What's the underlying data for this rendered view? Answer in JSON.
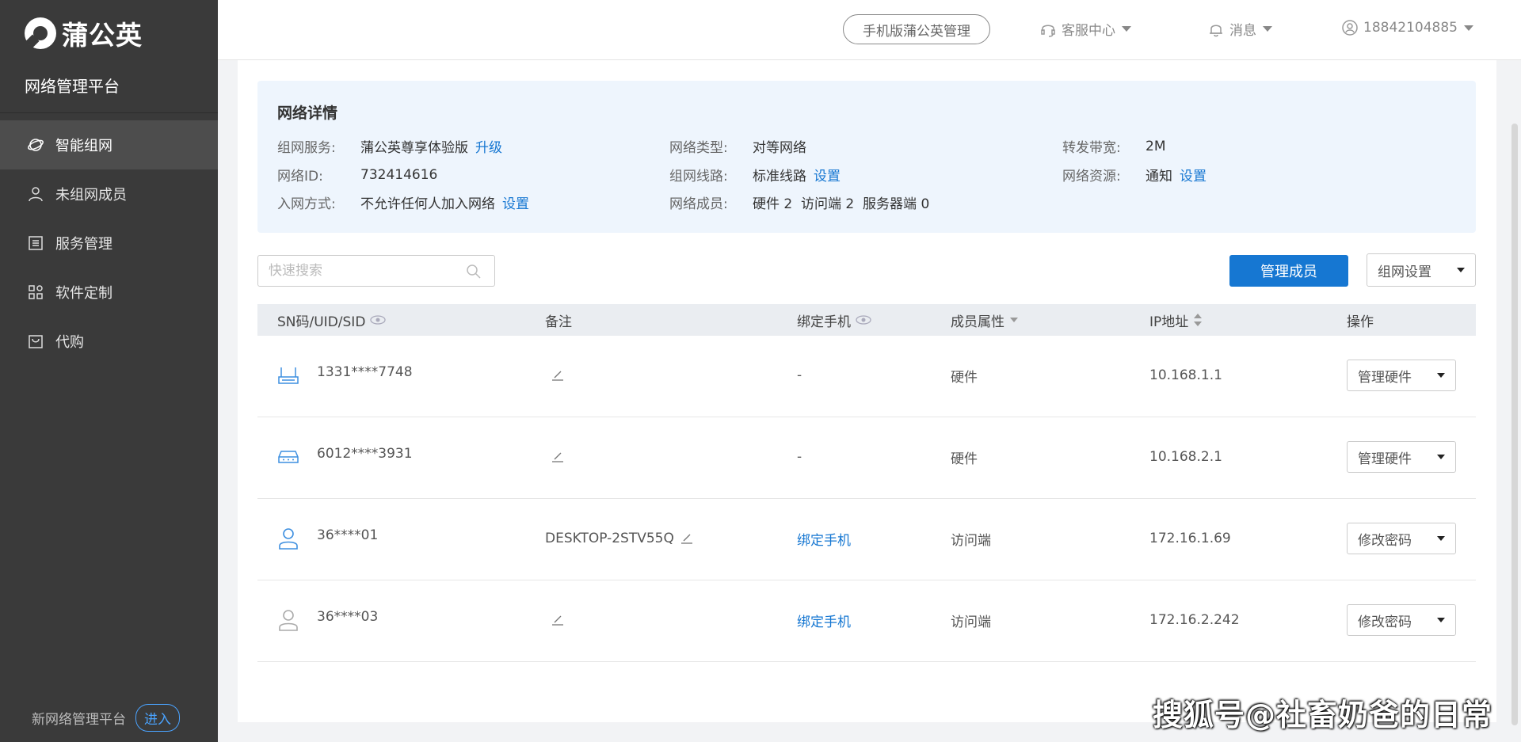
{
  "brand": {
    "name": "蒲公英",
    "platform_title": "网络管理平台"
  },
  "sidebar": {
    "items": [
      {
        "label": "智能组网",
        "icon": "network-icon",
        "active": true
      },
      {
        "label": "未组网成员",
        "icon": "user-icon"
      },
      {
        "label": "服务管理",
        "icon": "list-icon"
      },
      {
        "label": "软件定制",
        "icon": "grid-icon"
      },
      {
        "label": "代购",
        "icon": "bag-icon"
      }
    ],
    "footer_text": "新网络管理平台",
    "footer_button": "进入"
  },
  "topbar": {
    "mobile_button": "手机版蒲公英管理",
    "support": "客服中心",
    "messages": "消息",
    "account": "18842104885"
  },
  "detail": {
    "title": "网络详情",
    "service_label": "组网服务:",
    "service_value": "蒲公英尊享体验版",
    "service_link": "升级",
    "type_label": "网络类型:",
    "type_value": "对等网络",
    "bandwidth_label": "转发带宽:",
    "bandwidth_value": "2M",
    "id_label": "网络ID:",
    "id_value": "732414616",
    "route_label": "组网线路:",
    "route_value": "标准线路",
    "route_link": "设置",
    "resource_label": "网络资源:",
    "resource_value": "通知",
    "resource_link": "设置",
    "join_label": "入网方式:",
    "join_value": "不允许任何人加入网络",
    "join_link": "设置",
    "members_label": "网络成员:",
    "members_value": "硬件 2  访问端 2  服务器端 0"
  },
  "toolbar": {
    "search_placeholder": "快速搜索",
    "manage_members": "管理成员",
    "network_settings": "组网设置"
  },
  "table": {
    "columns": {
      "sn": "SN码/UID/SID",
      "note": "备注",
      "phone": "绑定手机",
      "attr": "成员属性",
      "ip": "IP地址",
      "action": "操作"
    },
    "rows": [
      {
        "icon": "router-icon",
        "sn": "1331****7748",
        "note": "",
        "phone": "-",
        "phone_link": false,
        "attr": "硬件",
        "ip": "10.168.1.1",
        "action": "管理硬件"
      },
      {
        "icon": "box-router-icon",
        "sn": "6012****3931",
        "note": "",
        "phone": "-",
        "phone_link": false,
        "attr": "硬件",
        "ip": "10.168.2.1",
        "action": "管理硬件"
      },
      {
        "icon": "user-online-icon",
        "sn": "36****01",
        "note": "DESKTOP-2STV55Q",
        "phone": "绑定手机",
        "phone_link": true,
        "attr": "访问端",
        "ip": "172.16.1.69",
        "action": "修改密码"
      },
      {
        "icon": "user-offline-icon",
        "sn": "36****03",
        "note": "",
        "phone": "绑定手机",
        "phone_link": true,
        "attr": "访问端",
        "ip": "172.16.2.242",
        "action": "修改密码"
      }
    ]
  },
  "watermark": "搜狐号@社畜奶爸的日常",
  "colors": {
    "sidebar": "#3a3a3a",
    "accent": "#1677d2",
    "detail_bg": "#eef5fd"
  }
}
